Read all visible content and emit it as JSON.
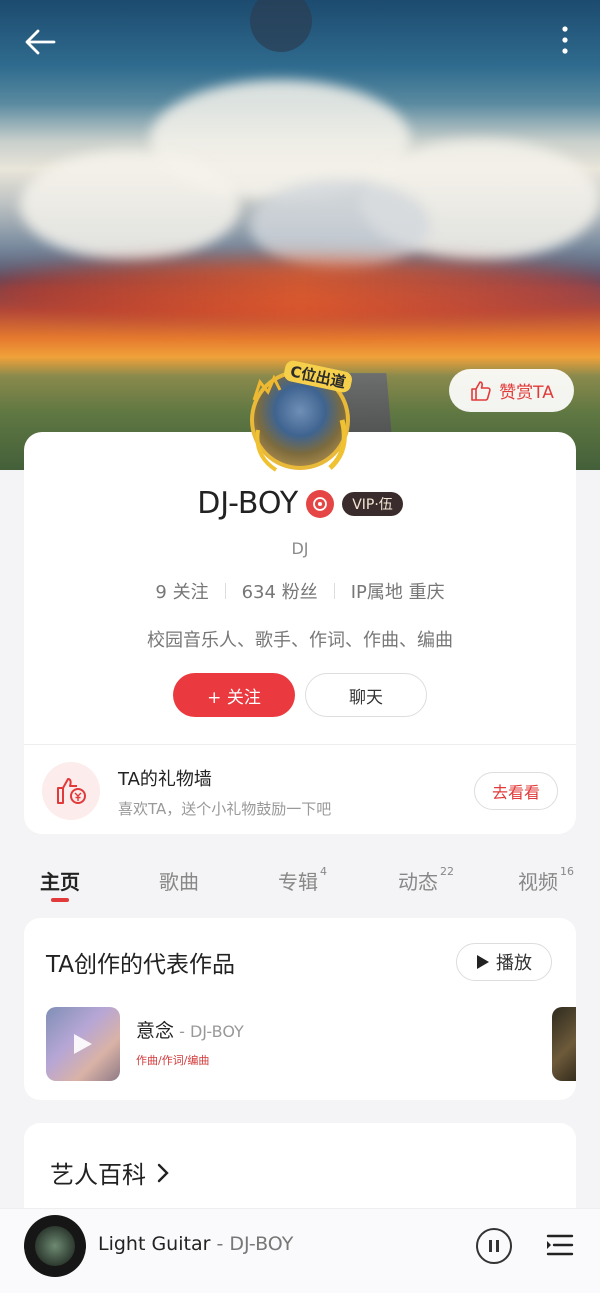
{
  "header": {
    "reward_label": "赞赏TA",
    "crown_label": "C位出道"
  },
  "profile": {
    "name": "DJ-BOY",
    "vip_label": "VIP·伍",
    "subtitle": "DJ",
    "following": "9 关注",
    "followers": "634 粉丝",
    "ip_location": "IP属地 重庆",
    "bio": "校园音乐人、歌手、作词、作曲、编曲",
    "follow_label": "+ 关注",
    "chat_label": "聊天"
  },
  "gift": {
    "title": "TA的礼物墙",
    "desc": "喜欢TA，送个小礼物鼓励一下吧",
    "button": "去看看"
  },
  "tabs": [
    {
      "label": "主页",
      "count": ""
    },
    {
      "label": "歌曲",
      "count": ""
    },
    {
      "label": "专辑",
      "count": "4"
    },
    {
      "label": "动态",
      "count": "22"
    },
    {
      "label": "视频",
      "count": "16"
    }
  ],
  "works": {
    "title": "TA创作的代表作品",
    "play_label": "播放",
    "song": {
      "title": "意念",
      "artist": " - DJ-BOY",
      "tags": "作曲/作词/编曲"
    }
  },
  "wiki": {
    "title": "艺人百科"
  },
  "player": {
    "title": "Light Guitar",
    "artist": " - DJ-BOY"
  },
  "colors": {
    "accent": "#ea3a3f",
    "background": "#f4f4f6"
  },
  "icons": [
    "back-arrow-icon",
    "more-vert-icon",
    "thumbs-up-icon",
    "music-note-icon",
    "play-icon",
    "chevron-right-icon",
    "pause-icon",
    "playlist-icon"
  ]
}
